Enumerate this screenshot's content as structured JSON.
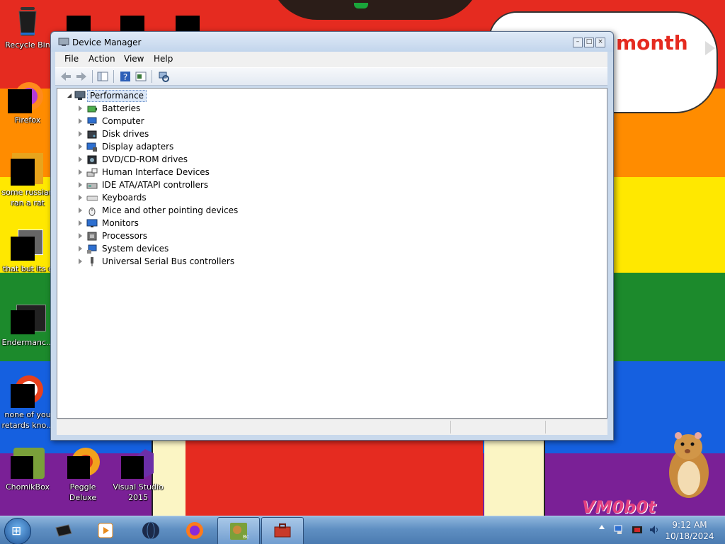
{
  "desktop": {
    "wallpaper_bubble_text": "month",
    "watermark": "VM0b0t",
    "icons": [
      {
        "label": "Recycle Bin"
      },
      {
        "label": "Firefox"
      },
      {
        "label": "some russian ran a rat"
      },
      {
        "label": "that but its c"
      },
      {
        "label": "Endermanc..."
      },
      {
        "label": "none of you retards kno..."
      },
      {
        "label": "ChomikBox"
      },
      {
        "label": "Peggle Deluxe"
      },
      {
        "label": "Visual Studio 2015"
      }
    ]
  },
  "window": {
    "title": "Device Manager",
    "menu": [
      "File",
      "Action",
      "View",
      "Help"
    ],
    "tree": {
      "root": "Performance",
      "children": [
        {
          "label": "Batteries",
          "icon": "battery-icon"
        },
        {
          "label": "Computer",
          "icon": "computer-icon"
        },
        {
          "label": "Disk drives",
          "icon": "disk-drive-icon"
        },
        {
          "label": "Display adapters",
          "icon": "display-adapter-icon"
        },
        {
          "label": "DVD/CD-ROM drives",
          "icon": "dvd-drive-icon"
        },
        {
          "label": "Human Interface Devices",
          "icon": "hid-icon"
        },
        {
          "label": "IDE ATA/ATAPI controllers",
          "icon": "ide-controller-icon"
        },
        {
          "label": "Keyboards",
          "icon": "keyboard-icon"
        },
        {
          "label": "Mice and other pointing devices",
          "icon": "mouse-icon"
        },
        {
          "label": "Monitors",
          "icon": "monitor-icon"
        },
        {
          "label": "Processors",
          "icon": "processor-icon"
        },
        {
          "label": "System devices",
          "icon": "system-device-icon"
        },
        {
          "label": "Universal Serial Bus controllers",
          "icon": "usb-icon"
        }
      ]
    }
  },
  "taskbar": {
    "clock_time": "9:12 AM",
    "clock_date": "10/18/2024",
    "buttons": [
      "media-center-icon",
      "media-player-icon",
      "globe-icon",
      "firefox-icon",
      "chomikbox-icon",
      "toolbox-icon"
    ]
  },
  "colors": {
    "accent": "#4a7ab0",
    "selection": "#dce8f8"
  }
}
